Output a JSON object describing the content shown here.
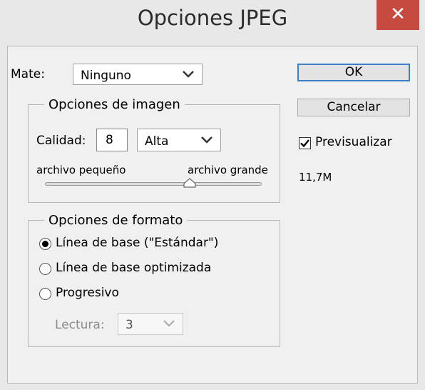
{
  "window": {
    "title": "Opciones JPEG",
    "close_label": "✕"
  },
  "mate": {
    "label": "Mate:",
    "value": "Ninguno"
  },
  "image_options": {
    "legend": "Opciones de imagen",
    "quality_label": "Calidad:",
    "quality_value": "8",
    "quality_preset": "Alta",
    "small_file_label": "archivo pequeño",
    "large_file_label": "archivo grande",
    "slider_value": 0.667
  },
  "format_options": {
    "legend": "Opciones de formato",
    "options": [
      {
        "label": "Línea de base (\"Estándar\")",
        "selected": true
      },
      {
        "label": "Línea de base optimizada",
        "selected": false
      },
      {
        "label": "Progresivo",
        "selected": false
      }
    ],
    "scans_label": "Lectura:",
    "scans_value": "3"
  },
  "buttons": {
    "ok": "OK",
    "cancel": "Cancelar"
  },
  "preview": {
    "label": "Previsualizar",
    "checked": true,
    "file_size": "11,7M"
  }
}
